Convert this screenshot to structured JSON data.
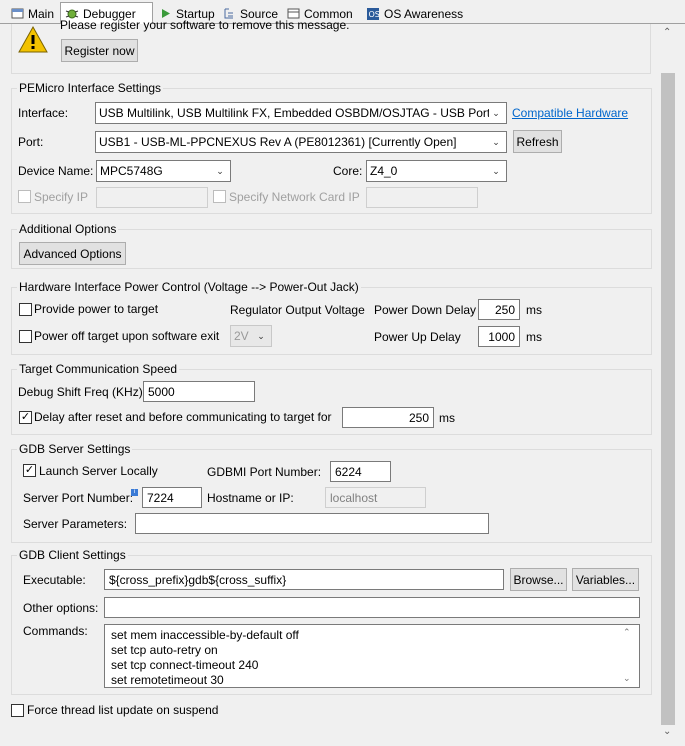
{
  "tabs": [
    {
      "label": "Main",
      "icon": "main-tab-icon"
    },
    {
      "label": "Debugger",
      "icon": "bug-icon"
    },
    {
      "label": "Startup",
      "icon": "play-icon"
    },
    {
      "label": "Source",
      "icon": "source-icon"
    },
    {
      "label": "Common",
      "icon": "common-icon"
    },
    {
      "label": "OS Awareness",
      "icon": "os-icon"
    }
  ],
  "warning": {
    "message": "Please register your software to remove this message.",
    "register_button": "Register now"
  },
  "pemicro": {
    "title": "PEMicro Interface Settings",
    "interface_label": "Interface:",
    "interface_value": "USB Multilink, USB Multilink FX, Embedded OSBDM/OSJTAG - USB Port",
    "compatible_link": "Compatible Hardware",
    "port_label": "Port:",
    "port_value": "USB1 - USB-ML-PPCNEXUS Rev A (PE8012361) [Currently Open]",
    "refresh_button": "Refresh",
    "device_label": "Device Name:",
    "device_value": "MPC5748G",
    "core_label": "Core:",
    "core_value": "Z4_0",
    "specify_ip_label": "Specify IP",
    "specify_nic_label": "Specify Network Card IP"
  },
  "additional": {
    "title": "Additional Options",
    "advanced_button": "Advanced Options"
  },
  "power": {
    "title": "Hardware Interface Power Control (Voltage --> Power-Out Jack)",
    "provide_label": "Provide power to target",
    "regulator_label": "Regulator Output Voltage",
    "power_down_label": "Power Down Delay",
    "power_down_value": "250",
    "power_down_unit": "ms",
    "power_off_label": "Power off target upon software exit",
    "voltage_value": "2V",
    "power_up_label": "Power Up Delay",
    "power_up_value": "1000",
    "power_up_unit": "ms"
  },
  "comm": {
    "title": "Target Communication Speed",
    "shift_label": "Debug Shift Freq (KHz)",
    "shift_value": "5000",
    "delay_label": "Delay after reset and before communicating to target for",
    "delay_value": "250",
    "delay_unit": "ms"
  },
  "gdb_server": {
    "title": "GDB Server Settings",
    "launch_label": "Launch Server Locally",
    "gdbmi_label": "GDBMI Port Number:",
    "gdbmi_value": "6224",
    "server_port_label": "Server Port Number:",
    "server_port_value": "7224",
    "hostname_label": "Hostname or IP:",
    "hostname_value": "localhost",
    "params_label": "Server Parameters:",
    "params_value": ""
  },
  "gdb_client": {
    "title": "GDB Client Settings",
    "exe_label": "Executable:",
    "exe_value": "${cross_prefix}gdb${cross_suffix}",
    "browse_button": "Browse...",
    "variables_button": "Variables...",
    "other_label": "Other options:",
    "other_value": "",
    "commands_label": "Commands:",
    "commands": [
      "set mem inaccessible-by-default off",
      "set tcp auto-retry on",
      "set tcp connect-timeout 240",
      "set remotetimeout 30"
    ]
  },
  "force_label": "Force thread list update on suspend"
}
